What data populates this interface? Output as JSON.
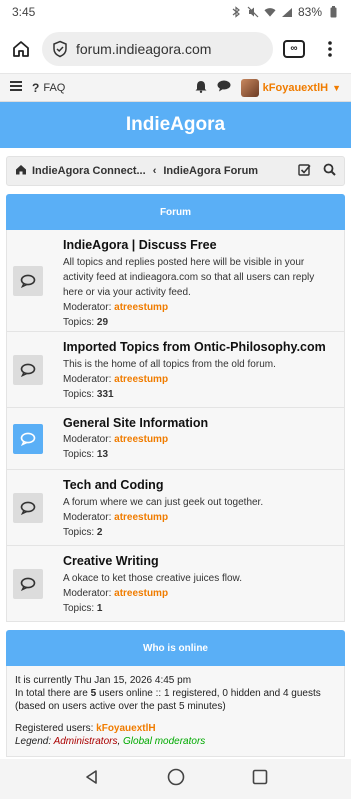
{
  "status": {
    "time": "3:45",
    "battery": "83%"
  },
  "browser": {
    "url": "forum.indieagora.com"
  },
  "nav": {
    "faq": "FAQ",
    "username": "kFoyauextlH"
  },
  "site": {
    "title": "IndieAgora"
  },
  "breadcrumb": {
    "home": "IndieAgora Connect...",
    "separator": "‹",
    "current": "IndieAgora Forum"
  },
  "forum": {
    "header": "Forum",
    "moderator_label": "Moderator:",
    "topics_label": "Topics:",
    "items": [
      {
        "title": "IndieAgora | Discuss Free",
        "description": "All topics and replies posted here will be visible in your activity feed at indieagora.com so that all users can reply here or via your activity feed.",
        "moderator": "atreestump",
        "topics": "29"
      },
      {
        "title": "Imported Topics from Ontic-Philosophy.com",
        "description": "This is the home of all topics from the old forum.",
        "moderator": "atreestump",
        "topics": "331"
      },
      {
        "title": "General Site Information",
        "description": "",
        "moderator": "atreestump",
        "topics": "13"
      },
      {
        "title": "Tech and Coding",
        "description": "A forum where we can just geek out together.",
        "moderator": "atreestump",
        "topics": "2"
      },
      {
        "title": "Creative Writing",
        "description": "A okace to ket those creative juices flow.",
        "moderator": "atreestump",
        "topics": "1"
      }
    ]
  },
  "online": {
    "header": "Who is online",
    "current_time": "It is currently Thu Jan 15, 2026 4:45 pm",
    "total_prefix": "In total there are ",
    "total_count": "5",
    "total_suffix": " users online :: 1 registered, 0 hidden and 4 guests (based on users active over the past 5 minutes)",
    "registered_label": "Registered users: ",
    "registered_user": "kFoyauextlH",
    "legend_label": "Legend: ",
    "legend_admins": "Administrators",
    "legend_sep": ", ",
    "legend_global": "Global moderators"
  }
}
